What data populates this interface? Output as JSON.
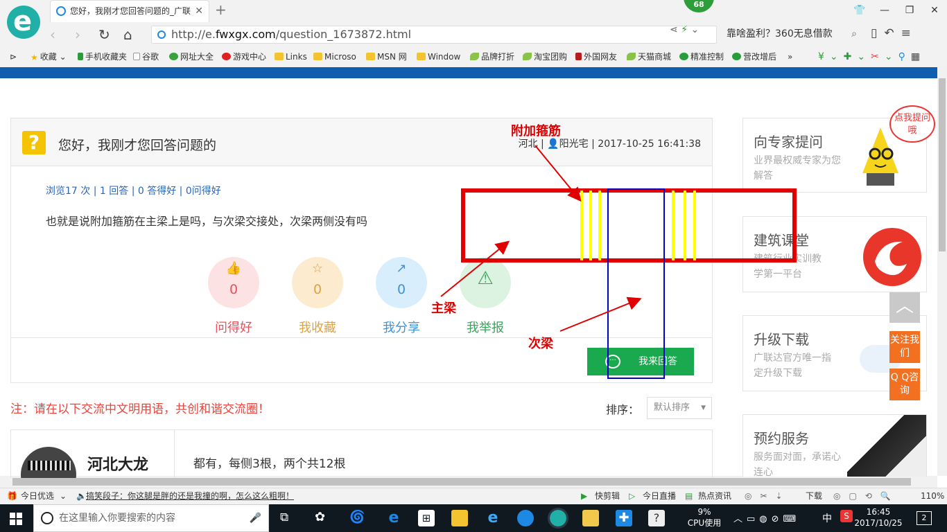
{
  "browser": {
    "tab_title": "您好，我刚才您回答问题的_广联",
    "tab_close": "✕",
    "new_tab": "+",
    "badge": "68",
    "url_prefix": "http://e.",
    "url_domain": "fwxgx.com",
    "url_path": "/question_1673872.html",
    "search_text": "靠啥盈利？360无息借款",
    "bookmarks": [
      "收藏",
      "手机收藏夹",
      "谷歌",
      "网址大全",
      "游戏中心",
      "Links",
      "Microso",
      "MSN 网",
      "Window",
      "品牌打折",
      "淘宝团购",
      "外国网友",
      "天猫商城",
      "精准控制",
      "营改增后"
    ],
    "more": "»"
  },
  "question": {
    "icon": "?",
    "title": "您好，我刚才您回答问题的",
    "meta_location": "河北",
    "meta_user": "阳光宅",
    "meta_time": "2017-10-25 16:41:38",
    "stats": "浏览17 次 | 1 回答 | 0 答得好 | 0问得好",
    "text": "也就是说附加箍筋在主梁上是吗，与次梁交接处，次梁两侧没有吗",
    "actions": [
      {
        "label": "问得好",
        "count": "0",
        "color": "#e8505b",
        "bg": "#fde2e4"
      },
      {
        "label": "我收藏",
        "count": "0",
        "color": "#e0a23a",
        "bg": "#fdebd0"
      },
      {
        "label": "我分享",
        "count": "0",
        "color": "#3c93d8",
        "bg": "#d8eefc"
      },
      {
        "label": "我举报",
        "count": "",
        "color": "#3aa25a",
        "bg": "#dcf3e2"
      }
    ],
    "answer_button": "我来回答"
  },
  "note": "注：请在以下交流中文明用语，共创和谐交流圈！",
  "sort": {
    "label": "排序：",
    "value": "默认排序"
  },
  "answer": {
    "name": "河北大龙",
    "text": "都有，每侧3根，两个共12根"
  },
  "sidebar": {
    "bubble": "点我提问哦",
    "cards": [
      {
        "title": "向专家提问",
        "desc": "业界最权威专家为您解答"
      },
      {
        "title": "建筑课堂",
        "desc": "建筑行业实训教学第一平台"
      },
      {
        "title": "升级下载",
        "desc": "广联达官方唯一指定升级下载"
      },
      {
        "title": "预约服务",
        "desc": "服务面对面，承诺心连心"
      }
    ],
    "follow": "关注我们",
    "qq": "Q Q咨询"
  },
  "annotations": {
    "stirrup_label": "附加箍筋",
    "main_beam_label": "主梁",
    "secondary_beam_label": "次梁",
    "red_color": "#e00000",
    "blue_color": "#0000c8",
    "yellow_color": "#ffff00"
  },
  "statusbar": {
    "left": "今日优选",
    "news": "搞笑段子：你这腿是胖的还是我撞的啊，怎么这么粗啊！",
    "items": [
      "快剪辑",
      "今日直播",
      "热点资讯",
      "下载"
    ],
    "zoom": "110%"
  },
  "taskbar": {
    "search_placeholder": "在这里输入你要搜索的内容",
    "cpu_percent": "9%",
    "cpu_label": "CPU使用",
    "ime": "中",
    "time": "16:45",
    "date": "2017/10/25",
    "notifications": "2"
  }
}
